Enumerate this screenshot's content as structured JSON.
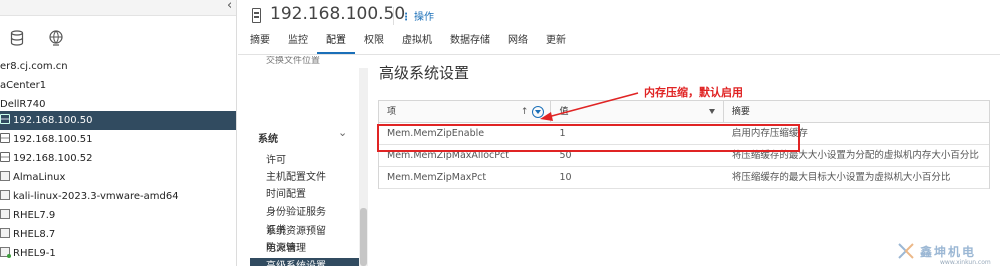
{
  "left_panel": {
    "tree": [
      {
        "label": "er8.cj.com.cn",
        "kind": "text"
      },
      {
        "label": "aCenter1",
        "kind": "text"
      },
      {
        "label": "DellR740",
        "kind": "text"
      },
      {
        "label": "192.168.100.50",
        "kind": "host",
        "selected": true
      },
      {
        "label": "192.168.100.51",
        "kind": "host"
      },
      {
        "label": "192.168.100.52",
        "kind": "host"
      },
      {
        "label": "AlmaLinux",
        "kind": "vm"
      },
      {
        "label": "kali-linux-2023.3-vmware-amd64",
        "kind": "vm"
      },
      {
        "label": "RHEL7.9",
        "kind": "vm"
      },
      {
        "label": "RHEL8.7",
        "kind": "vm"
      },
      {
        "label": "RHEL9-1",
        "kind": "vm-on"
      }
    ]
  },
  "header": {
    "title": "192.168.100.50",
    "actions_label": "操作",
    "tabs": [
      "摘要",
      "监控",
      "配置",
      "权限",
      "虚拟机",
      "数据存储",
      "网络",
      "更新"
    ]
  },
  "subnav": {
    "clipped_label": "交换文件位置",
    "section_label": "系统",
    "items": [
      "许可",
      "主机配置文件",
      "时间配置",
      "身份验证服务",
      "证书",
      "电源管理",
      "高级系统设置",
      "系统资源预留",
      "防火墙"
    ]
  },
  "main": {
    "title": "高级系统设置",
    "columns": [
      "项",
      "值",
      "摘要"
    ],
    "rows": [
      {
        "key": "Mem.MemZipEnable",
        "value": "1",
        "summary": "启用内存压缩缓存"
      },
      {
        "key": "Mem.MemZipMaxAllocPct",
        "value": "50",
        "summary": "将压缩缓存的最大大小设置为分配的虚拟机内存大小百分比"
      },
      {
        "key": "Mem.MemZipMaxPct",
        "value": "10",
        "summary": "将压缩缓存的最大目标大小设置为虚拟机大小百分比"
      }
    ]
  },
  "annotation": {
    "text": "内存压缩，默认启用",
    "color": "#e02424"
  },
  "watermark": {
    "text": "鑫坤机电",
    "url": "www.xinkun.com"
  },
  "colors": {
    "selection": "#314b60",
    "accent": "#1a6fb8"
  }
}
